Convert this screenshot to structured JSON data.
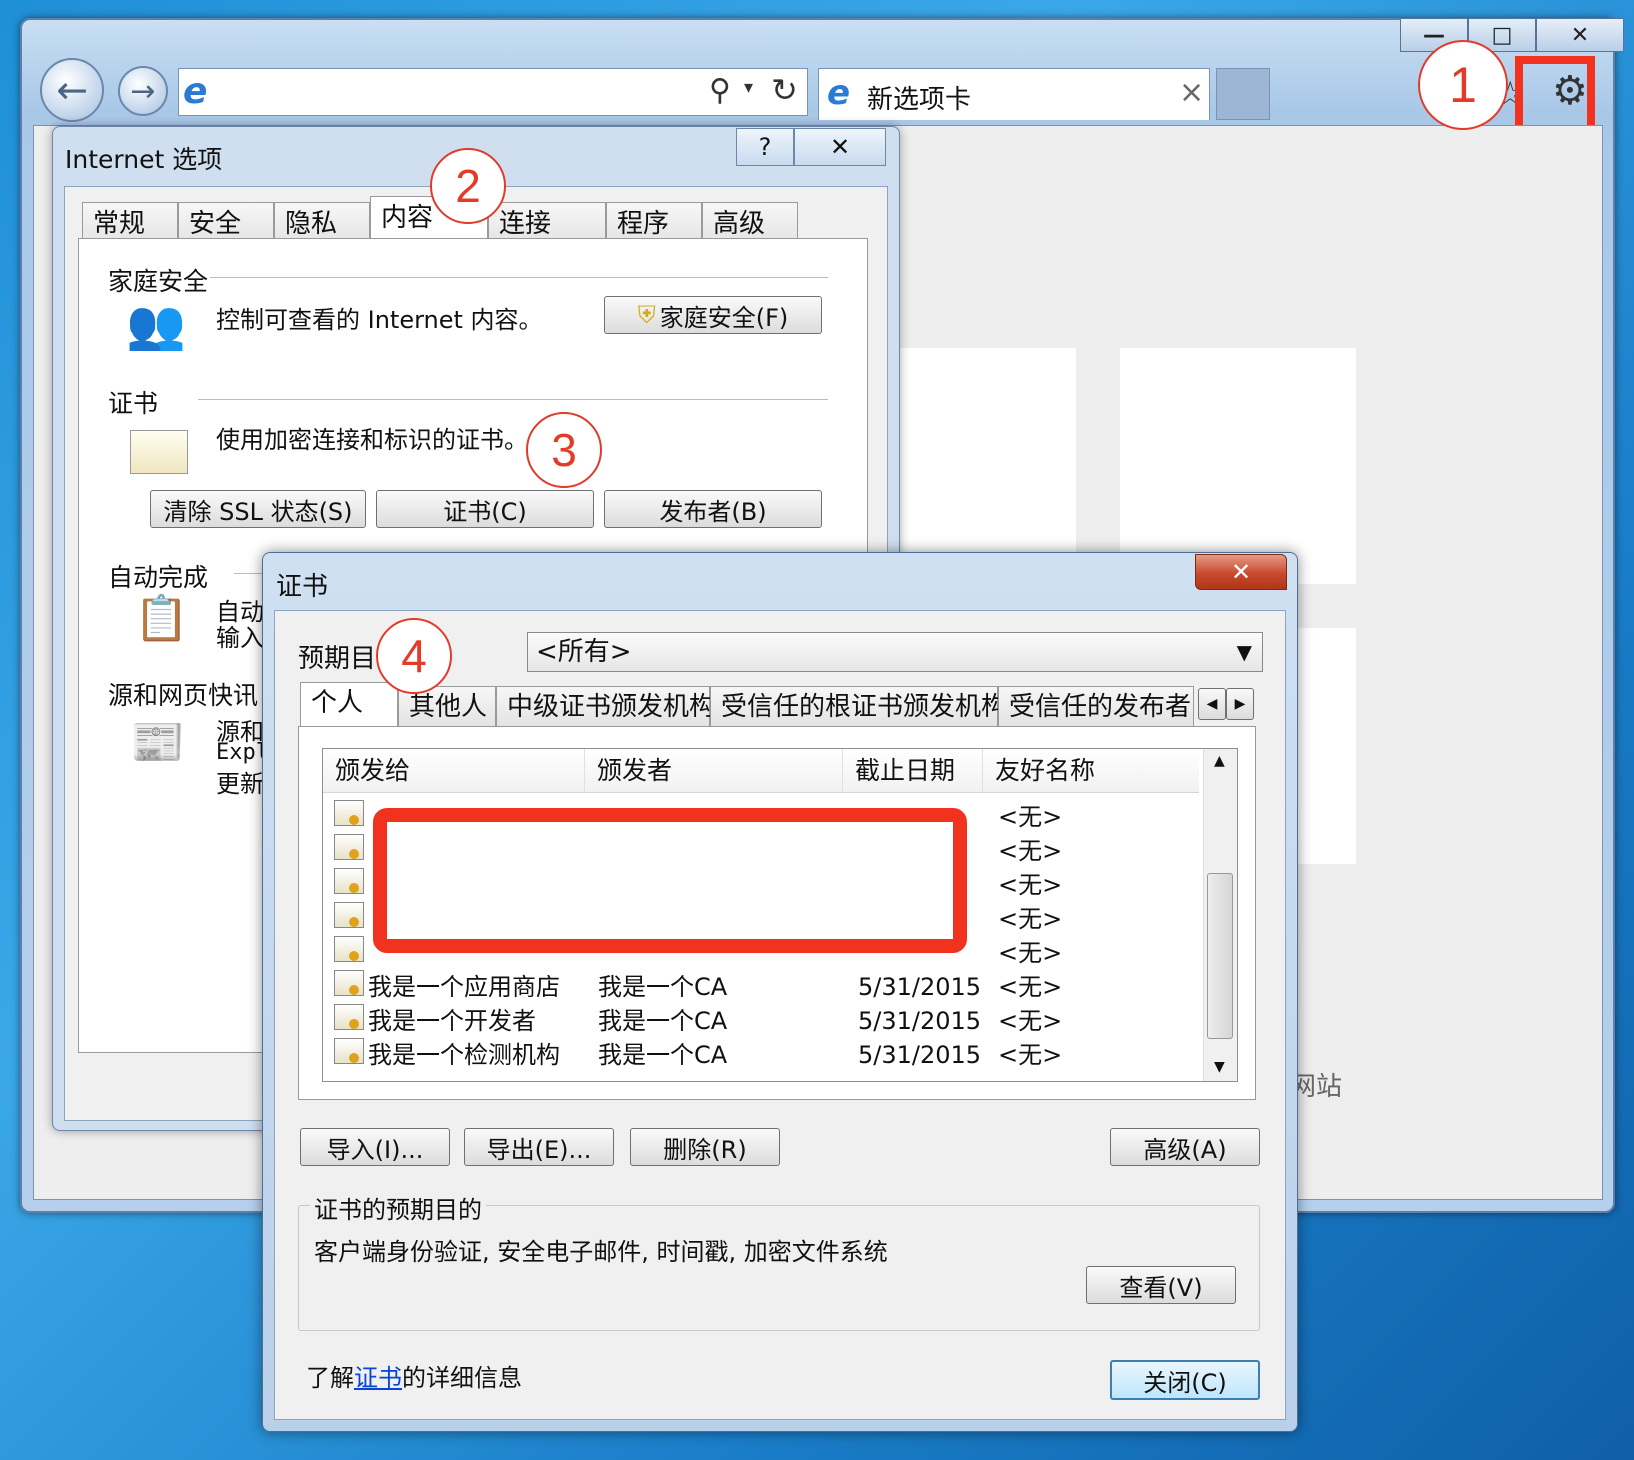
{
  "browser": {
    "tab_title": "新选项卡",
    "tab_close": "×",
    "window_buttons": {
      "minimize": "—",
      "maximize": "□",
      "close": "✕"
    },
    "partial_text": "网站"
  },
  "internet_options": {
    "title": "Internet 选项",
    "help": "?",
    "close": "✕",
    "tabs": [
      "常规",
      "安全",
      "隐私",
      "内容",
      "连接",
      "程序",
      "高级"
    ],
    "family_safety": {
      "heading": "家庭安全",
      "description": "控制可查看的 Internet 内容。",
      "button": "家庭安全(F)"
    },
    "certificates": {
      "heading": "证书",
      "description": "使用加密连接和标识的证书。",
      "btn_clear_ssl": "清除 SSL 状态(S)",
      "btn_certificates": "证书(C)",
      "btn_publishers": "发布者(B)"
    },
    "autocomplete": {
      "heading": "自动完成",
      "desc_line1": "自动",
      "desc_line2": "输入"
    },
    "feeds": {
      "heading": "源和网页快讯",
      "desc_line1": "源和",
      "desc_line2": "Expl",
      "desc_line3": "更新"
    }
  },
  "cert_dialog": {
    "title": "证书",
    "close": "✕",
    "purpose_label": "预期目的",
    "purpose_value": "<所有>",
    "tabs": [
      "个人",
      "其他人",
      "中级证书颁发机构",
      "受信任的根证书颁发机构",
      "受信任的发布者"
    ],
    "columns": [
      "颁发给",
      "颁发者",
      "截止日期",
      "友好名称"
    ],
    "redacted_rows": [
      {
        "friendly": "<无>"
      },
      {
        "friendly": "<无>"
      },
      {
        "friendly": "<无>"
      },
      {
        "friendly": "<无>"
      },
      {
        "friendly": "<无>"
      }
    ],
    "rows": [
      {
        "issued_to": "我是一个应用商店",
        "issued_by": "我是一个CA",
        "expires": "5/31/2015",
        "friendly": "<无>"
      },
      {
        "issued_to": "我是一个开发者",
        "issued_by": "我是一个CA",
        "expires": "5/31/2015",
        "friendly": "<无>"
      },
      {
        "issued_to": "我是一个检测机构",
        "issued_by": "我是一个CA",
        "expires": "5/31/2015",
        "friendly": "<无>"
      }
    ],
    "btn_import": "导入(I)...",
    "btn_export": "导出(E)...",
    "btn_remove": "删除(R)",
    "btn_advanced": "高级(A)",
    "purposes_heading": "证书的预期目的",
    "purposes_text": "客户端身份验证, 安全电子邮件, 时间戳, 加密文件系统",
    "btn_view": "查看(V)",
    "learn_prefix": "了解",
    "learn_link": "证书",
    "learn_suffix": "的详细信息",
    "btn_close": "关闭(C)"
  },
  "callouts": [
    "1",
    "2",
    "3",
    "4"
  ],
  "colors": {
    "accent_red": "#e23b2a",
    "link_blue": "#0645d6"
  }
}
